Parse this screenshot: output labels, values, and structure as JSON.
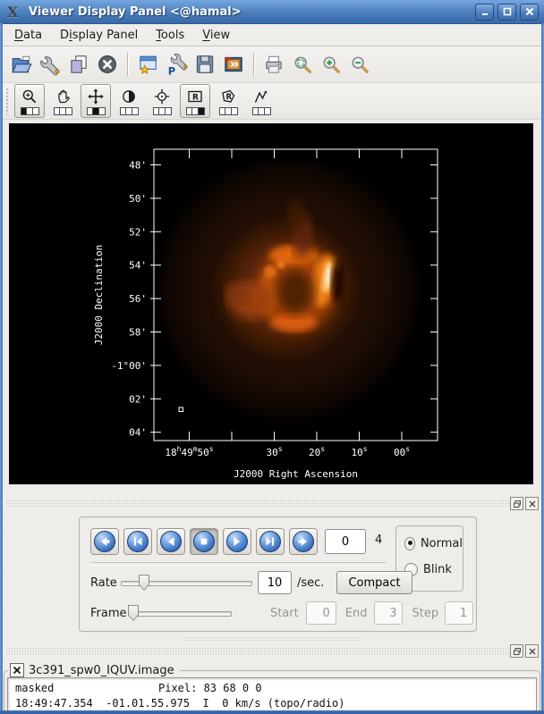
{
  "window": {
    "title": "Viewer Display Panel <@hamal>",
    "controls": [
      {
        "name": "minimize"
      },
      {
        "name": "maximize"
      },
      {
        "name": "close"
      }
    ]
  },
  "colors": {
    "titlebar_top": "#74a5de",
    "titlebar_bottom": "#3a6aa8",
    "window_border": "#4d82c0",
    "panel_bg": "#efedea",
    "canvas_bg": "#000000",
    "plot_foreground": "#ffffff",
    "nebula_hot": "#ff8c1a",
    "animator_button_blue": "#3c72c0"
  },
  "menubar": {
    "items": [
      {
        "label": "Data",
        "underline_index": 0
      },
      {
        "label": "Display Panel",
        "underline_index": 1
      },
      {
        "label": "Tools",
        "underline_index": 0
      },
      {
        "label": "View",
        "underline_index": 0
      }
    ]
  },
  "main_toolbar": {
    "groups": [
      [
        "open-data",
        "adjust-data-display",
        "manage-images",
        "close-data"
      ],
      [
        "new-display-panel",
        "panel-display-options",
        "save-panel-state",
        "export-image"
      ],
      [
        "print",
        "zoom-region",
        "zoom-in",
        "zoom-out"
      ]
    ]
  },
  "mouse_toolbar": {
    "tools": [
      {
        "name": "zoom",
        "framed": true,
        "mouse_button": 1
      },
      {
        "name": "pan-hand",
        "framed": false,
        "mouse_button": 0
      },
      {
        "name": "shift",
        "framed": true,
        "mouse_button": 2
      },
      {
        "name": "stretch",
        "framed": false,
        "mouse_button": 0
      },
      {
        "name": "point",
        "framed": false,
        "mouse_button": 0
      },
      {
        "name": "rectangle-region",
        "framed": true,
        "mouse_button": 3
      },
      {
        "name": "polygon-region",
        "framed": false,
        "mouse_button": 0
      },
      {
        "name": "polyline",
        "framed": false,
        "mouse_button": 0
      }
    ]
  },
  "canvas": {
    "ylabel": "J2000 Declination",
    "xlabel": "J2000 Right Ascension",
    "y_ticks": [
      "48'",
      "50'",
      "52'",
      "54'",
      "56'",
      "58'",
      "-1°00'",
      "02'",
      "04'"
    ],
    "x_ticks": [
      "18^h49^m50^s",
      "",
      "30^s",
      "20^s",
      "10^s",
      "00^s",
      ""
    ]
  },
  "animator": {
    "buttons": [
      {
        "name": "jump-start",
        "pressed": false
      },
      {
        "name": "step-back",
        "pressed": false
      },
      {
        "name": "play-reverse",
        "pressed": false
      },
      {
        "name": "stop",
        "pressed": true
      },
      {
        "name": "play-forward",
        "pressed": false
      },
      {
        "name": "step-forward",
        "pressed": false
      },
      {
        "name": "jump-end",
        "pressed": false
      }
    ],
    "current_frame": "0",
    "frame_count": "4",
    "modes": [
      {
        "label": "Normal",
        "selected": true
      },
      {
        "label": "Blink",
        "selected": false
      }
    ],
    "rate_label": "Rate",
    "rate_value": "10",
    "rate_unit": "/sec.",
    "compact_button": "Compact",
    "frame_label": "Frame",
    "start_label": "Start",
    "start_value": "0",
    "end_label": "End",
    "end_value": "3",
    "step_label": "Step",
    "step_value": "1"
  },
  "tracking": {
    "title": "3c391_spw0_IQUV.image",
    "line1_left": "masked",
    "line1_right": "Pixel: 83 68 0 0",
    "line2": "18:49:47.354  -01.01.55.975  I  0 km/s (topo/radio)"
  }
}
